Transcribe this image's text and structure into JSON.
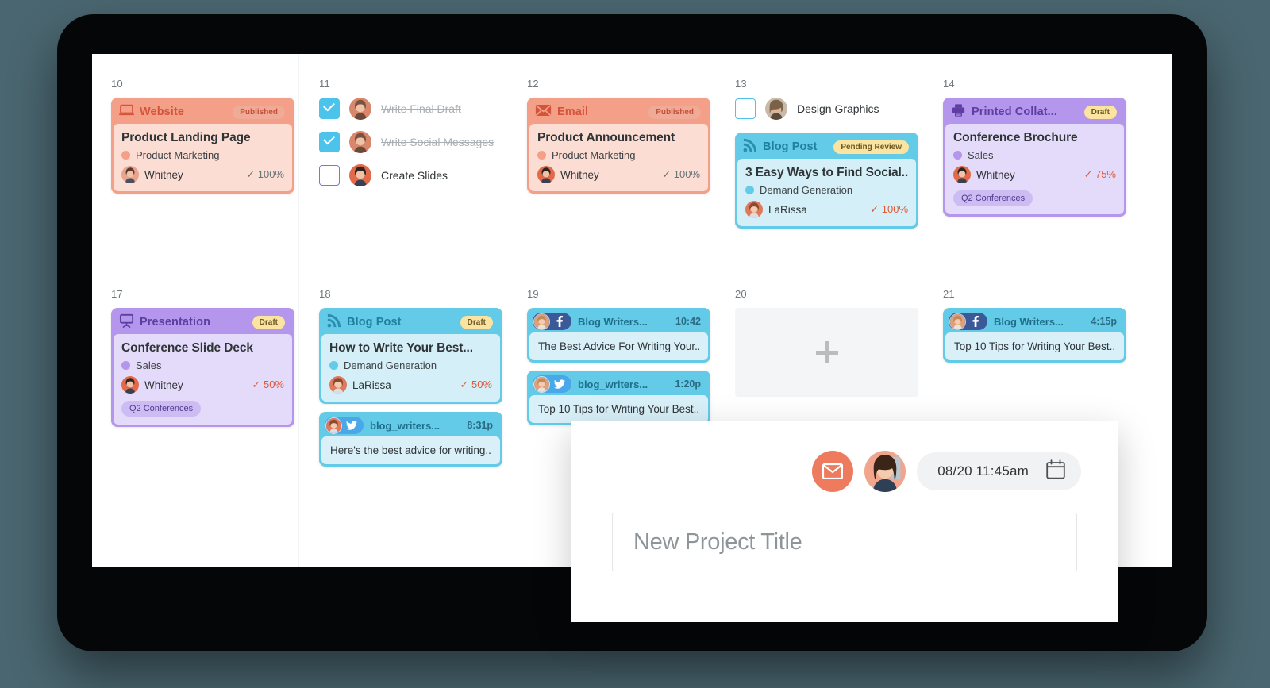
{
  "app": {
    "background_color": "#4a6670",
    "device_color": "#050608",
    "screen_color": "#ffffff"
  },
  "calendar": {
    "rows": [
      {
        "days": [
          {
            "number": "10",
            "items": [
              {
                "kind": "project",
                "type_label": "Website",
                "icon": "laptop-icon",
                "badge": "Published",
                "title": "Product Landing Page",
                "category": "Product Marketing",
                "assignee": "Whitney",
                "percent": "100%",
                "tag": null,
                "theme": "salmon"
              }
            ]
          },
          {
            "number": "11",
            "items": [
              {
                "kind": "task",
                "label": "Write Final Draft",
                "checked": true,
                "assignee": "Whitney"
              },
              {
                "kind": "task",
                "label": "Write Social Messages",
                "checked": true,
                "assignee": "Whitney"
              },
              {
                "kind": "task",
                "label": "Create Slides",
                "checked": false,
                "assignee": "Whitney"
              }
            ]
          },
          {
            "number": "12",
            "items": [
              {
                "kind": "project",
                "type_label": "Email",
                "icon": "envelope-icon",
                "badge": "Published",
                "title": "Product Announcement",
                "category": "Product Marketing",
                "assignee": "Whitney",
                "percent": "100%",
                "tag": null,
                "theme": "salmon"
              }
            ]
          },
          {
            "number": "13",
            "items": [
              {
                "kind": "task",
                "label": "Design Graphics",
                "checked": false,
                "assignee": "Designer"
              },
              {
                "kind": "project",
                "type_label": "Blog Post",
                "icon": "rss-icon",
                "badge": "Pending Review",
                "title": "3 Easy Ways to Find Social...",
                "category": "Demand Generation",
                "assignee": "LaRissa",
                "percent": "100%",
                "tag": null,
                "theme": "blue"
              }
            ]
          },
          {
            "number": "14",
            "items": [
              {
                "kind": "project",
                "type_label": "Printed Collat...",
                "icon": "printer-icon",
                "badge": "Draft",
                "title": "Conference Brochure",
                "category": "Sales",
                "assignee": "Whitney",
                "percent": "75%",
                "tag": "Q2 Conferences",
                "theme": "purple"
              }
            ]
          }
        ]
      },
      {
        "days": [
          {
            "number": "17",
            "items": [
              {
                "kind": "project",
                "type_label": "Presentation",
                "icon": "presentation-icon",
                "badge": "Draft",
                "title": "Conference Slide Deck",
                "category": "Sales",
                "assignee": "Whitney",
                "percent": "50%",
                "tag": "Q2 Conferences",
                "theme": "purple"
              }
            ]
          },
          {
            "number": "18",
            "items": [
              {
                "kind": "project",
                "type_label": "Blog Post",
                "icon": "rss-icon",
                "badge": "Draft",
                "title": "How to Write Your Best...",
                "category": "Demand Generation",
                "assignee": "LaRissa",
                "percent": "50%",
                "tag": null,
                "theme": "blue"
              },
              {
                "kind": "social",
                "network": "twitter",
                "handle": "blog_writers...",
                "time": "8:31p",
                "text": "Here's the best advice for writing..."
              }
            ]
          },
          {
            "number": "19",
            "items": [
              {
                "kind": "social",
                "network": "facebook",
                "handle": "Blog Writers...",
                "time": "10:42",
                "text": "The Best Advice For Writing Your..."
              },
              {
                "kind": "social",
                "network": "twitter",
                "handle": "blog_writers...",
                "time": "1:20p",
                "text": "Top 10 Tips for Writing Your Best..."
              }
            ]
          },
          {
            "number": "20",
            "items": [
              {
                "kind": "add",
                "icon": "plus-icon"
              }
            ]
          },
          {
            "number": "21",
            "items": [
              {
                "kind": "social",
                "network": "facebook",
                "handle": "Blog Writers...",
                "time": "4:15p",
                "text": "Top 10 Tips for Writing Your Best..."
              }
            ]
          }
        ]
      }
    ]
  },
  "modal": {
    "mail_icon": "envelope-icon",
    "avatar": "user-avatar",
    "date_value": "08/20  11:45am",
    "calendar_icon": "calendar-icon",
    "title_placeholder": "New Project Title"
  },
  "theme_colors": {
    "salmon_header": "#f4a089",
    "salmon_body": "#fbddd3",
    "salmon_text": "#d4543a",
    "blue_header": "#63cbe8",
    "blue_body": "#d4eff8",
    "blue_text": "#1f7f9e",
    "purple_header": "#b496ec",
    "purple_body": "#e4daf9",
    "purple_text": "#5d3fa3",
    "badge_yellow": "#fbe3a0",
    "checkbox_blue": "#4cc3ea",
    "accent_orange": "#ef7b5e"
  }
}
